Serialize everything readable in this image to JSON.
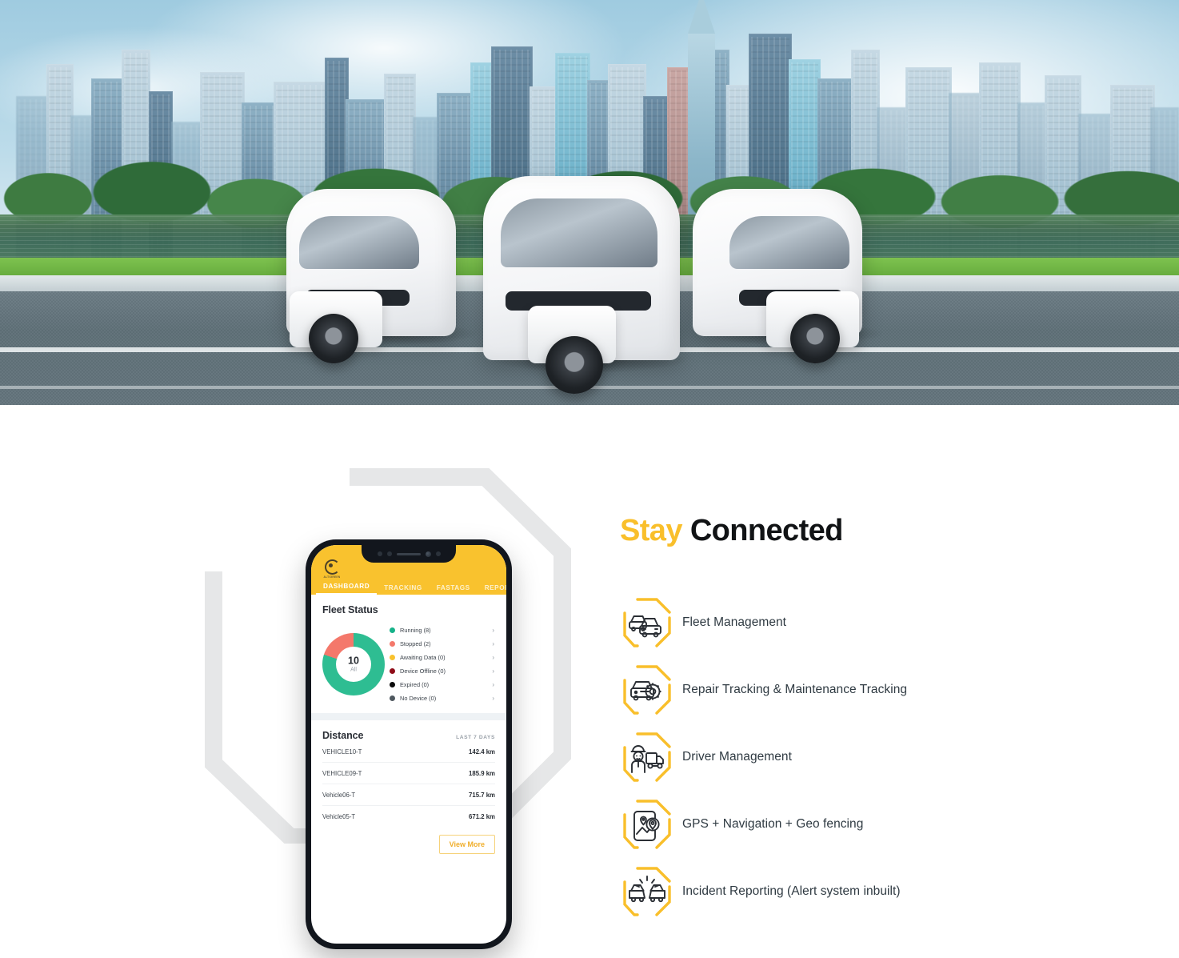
{
  "hero": {
    "alt": "Three white electric auto-rickshaws parked on a road in front of a city park, lake and skyline",
    "scene": {
      "sky": "#bddcea",
      "road": "#64757d",
      "grass": "#6fb845",
      "vehicle_body": "#ffffff"
    }
  },
  "section": {
    "title_highlight": "Stay",
    "title_rest": "Connected",
    "features": [
      {
        "icon": "fleet-cars-icon",
        "label": "Fleet Management"
      },
      {
        "icon": "repair-gear-car-icon",
        "label": "Repair Tracking & Maintenance Tracking"
      },
      {
        "icon": "driver-truck-icon",
        "label": "Driver Management"
      },
      {
        "icon": "gps-phone-pin-icon",
        "label": "GPS + Navigation + Geo fencing"
      },
      {
        "icon": "car-crash-icon",
        "label": "Incident Reporting (Alert system inbuilt)"
      }
    ],
    "accent": "#f9bf2b",
    "deco": "hexagon-outline-decoration"
  },
  "phone": {
    "app": {
      "logo_text": "ALTIGREEN",
      "tabs": [
        {
          "label": "DASHBOARD",
          "active": true
        },
        {
          "label": "TRACKING",
          "active": false
        },
        {
          "label": "FASTAGS",
          "active": false
        },
        {
          "label": "REPORT",
          "active": false
        }
      ],
      "fleet_status": {
        "title": "Fleet Status",
        "total": "10",
        "total_label": "All",
        "legend": [
          {
            "label": "Running (8)",
            "color": "#16b289",
            "value": 8
          },
          {
            "label": "Stopped (2)",
            "color": "#f4786b",
            "value": 2
          },
          {
            "label": "Awaiting Data (0)",
            "color": "#f9c22e",
            "value": 0
          },
          {
            "label": "Device Offline (0)",
            "color": "#8f0c18",
            "value": 0
          },
          {
            "label": "Expired (0)",
            "color": "#0b0b0b",
            "value": 0
          },
          {
            "label": "No Device (0)",
            "color": "#4f585f",
            "value": 0
          }
        ],
        "chevron": "›"
      },
      "distance": {
        "title": "Distance",
        "period": "LAST 7 DAYS",
        "rows": [
          {
            "vehicle": "VEHICLE10-T",
            "value": "142.4 km"
          },
          {
            "vehicle": "VEHICLE09-T",
            "value": "185.9 km"
          },
          {
            "vehicle": "Vehicle06-T",
            "value": "715.7 km"
          },
          {
            "vehicle": "Vehicle05-T",
            "value": "671.2 km"
          }
        ],
        "view_more": "View More"
      }
    }
  },
  "chart_data": {
    "type": "pie",
    "title": "Fleet Status",
    "categories": [
      "Running",
      "Stopped",
      "Awaiting Data",
      "Device Offline",
      "Expired",
      "No Device"
    ],
    "values": [
      8,
      2,
      0,
      0,
      0,
      0
    ],
    "colors": [
      "#16b289",
      "#f4786b",
      "#f9c22e",
      "#8f0c18",
      "#0b0b0b",
      "#4f585f"
    ],
    "center_value": "10",
    "center_label": "All",
    "legend_position": "right",
    "donut": true
  }
}
